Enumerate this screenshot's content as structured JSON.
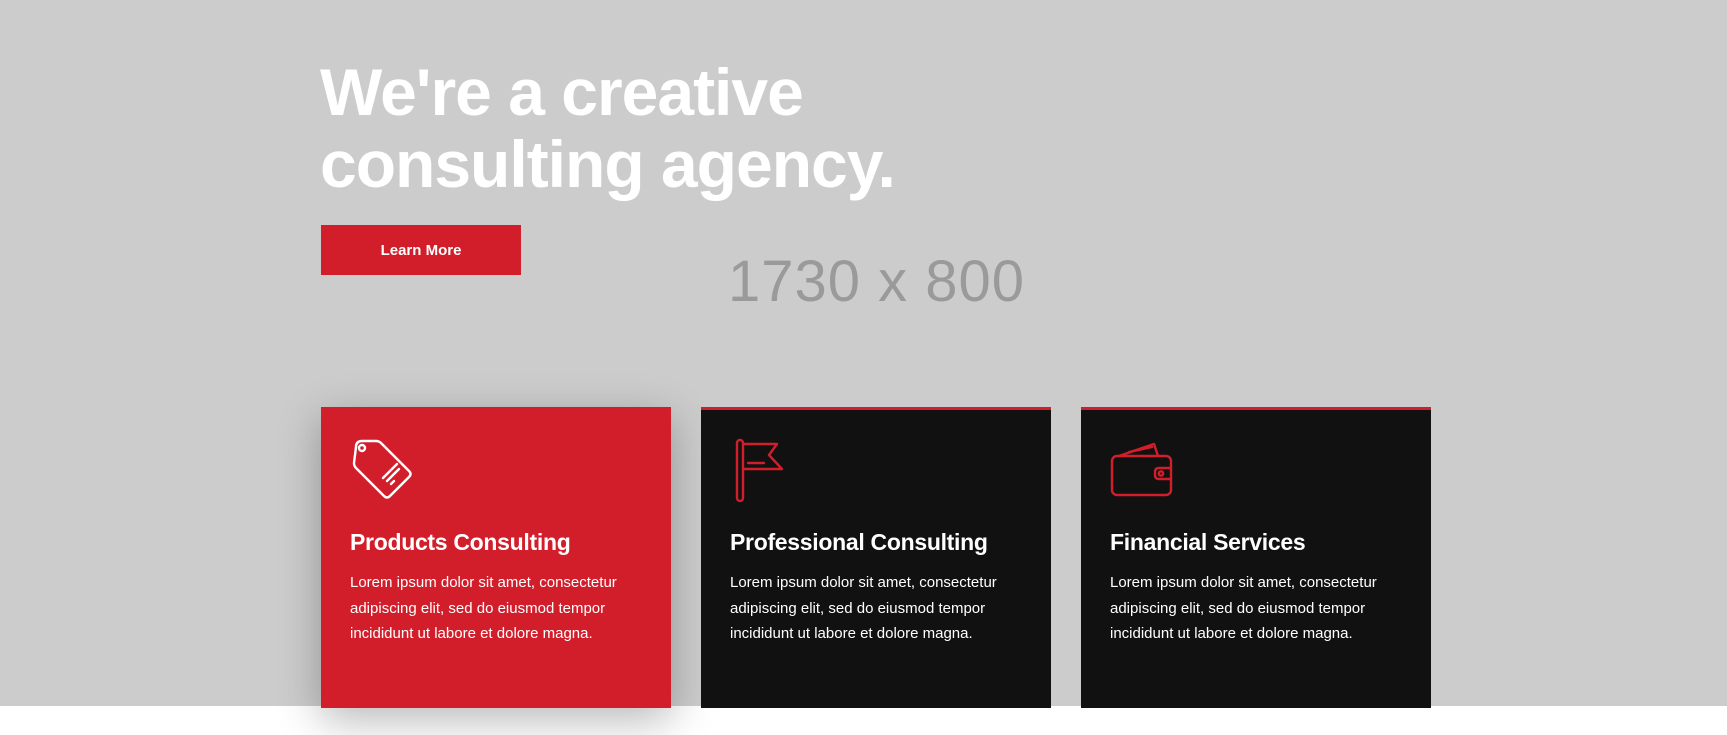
{
  "hero": {
    "placeholder_text": "1730 x 800",
    "headline_line1": "We're a creative",
    "headline_line2": "consulting agency.",
    "cta_label": "Learn More"
  },
  "cards": [
    {
      "icon": "price-tag-icon",
      "title": "Products Consulting",
      "text": "Lorem ipsum dolor sit amet, consectetur adipiscing elit, sed do eiusmod tempor incididunt ut labore et dolore magna."
    },
    {
      "icon": "flag-icon",
      "title": "Professional Consulting",
      "text": "Lorem ipsum dolor sit amet, consectetur adipiscing elit, sed do eiusmod tempor incididunt ut labore et dolore magna."
    },
    {
      "icon": "wallet-icon",
      "title": "Financial Services",
      "text": "Lorem ipsum dolor sit amet, consectetur adipiscing elit, sed do eiusmod tempor incididunt ut labore et dolore magna."
    }
  ],
  "colors": {
    "accent": "#d21e2b",
    "hero_background": "#cccccc",
    "card_dark": "#111111"
  }
}
